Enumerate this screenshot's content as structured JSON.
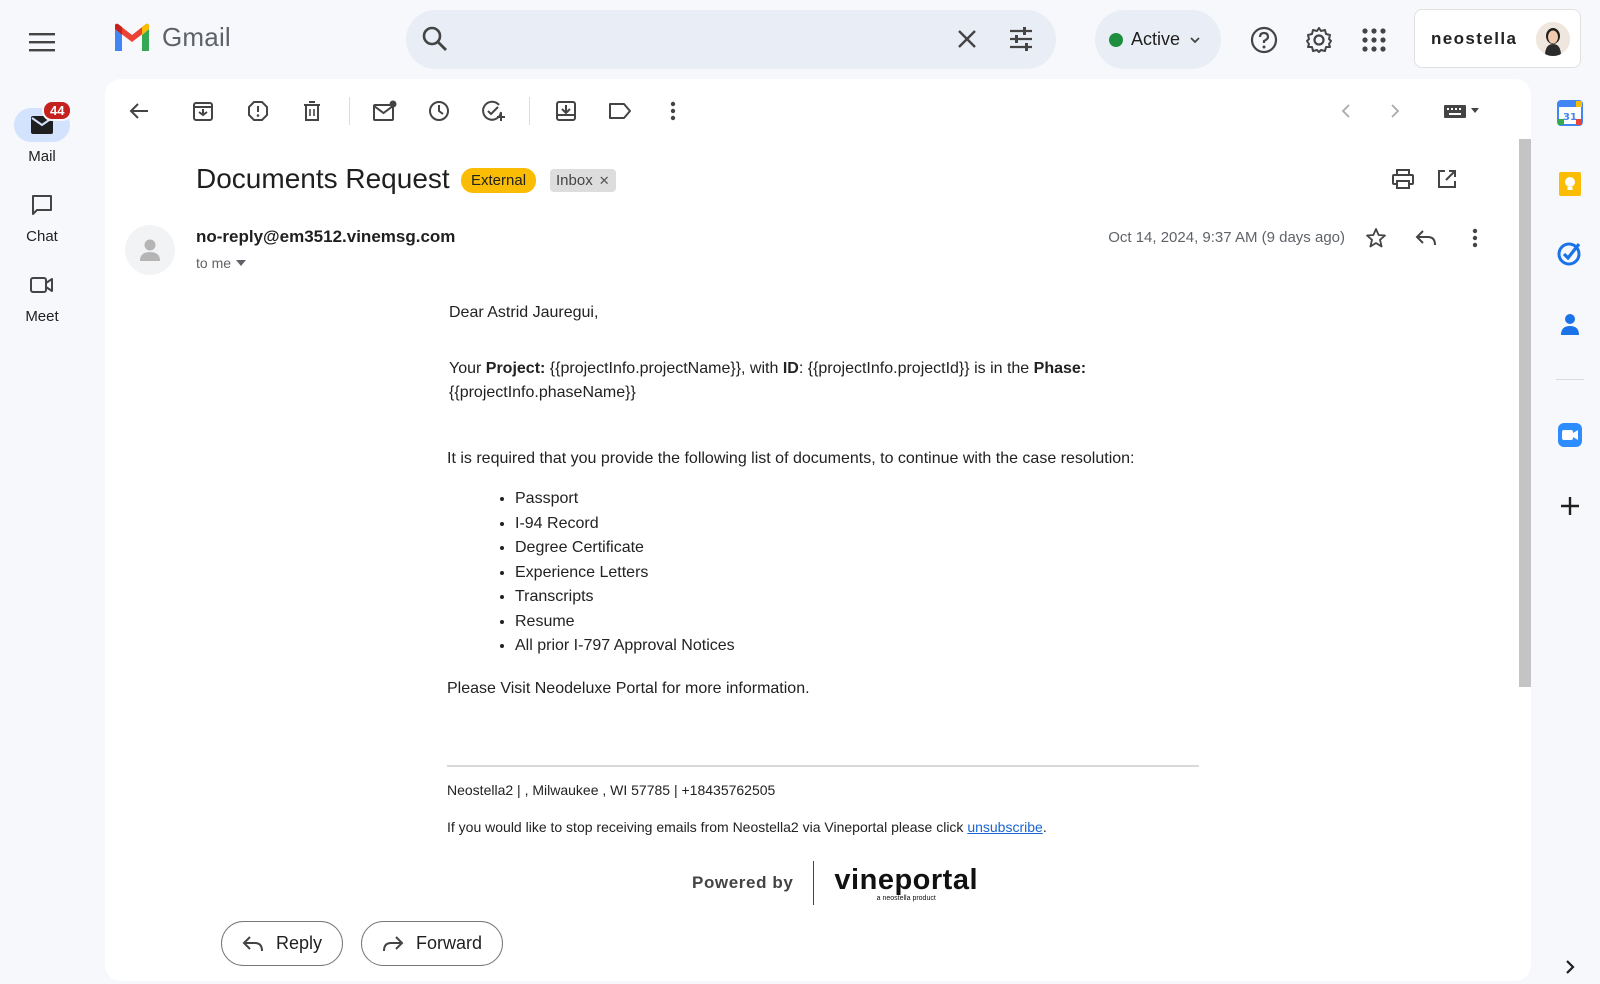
{
  "app": {
    "logo_text": "Gmail"
  },
  "search": {
    "value": "",
    "placeholder": ""
  },
  "status": {
    "label": "Active",
    "color": "#1e8e3e"
  },
  "account": {
    "brand": "neostella"
  },
  "rail": [
    {
      "label": "Mail",
      "badge": "44",
      "icon": "mail-icon",
      "active": true
    },
    {
      "label": "Chat",
      "icon": "chat-icon"
    },
    {
      "label": "Meet",
      "icon": "video-icon"
    }
  ],
  "email": {
    "subject": "Documents Request",
    "labels": {
      "external": "External",
      "inbox": "Inbox"
    },
    "sender": "no-reply@em3512.vinemsg.com",
    "to": "to me",
    "date": "Oct 14, 2024, 9:37 AM (9 days ago)",
    "greeting": "Dear Astrid Jauregui,",
    "para1": {
      "t1": "Your ",
      "b1": "Project:",
      "t2": " {{projectInfo.projectName}}, with ",
      "b2": "ID",
      "t3": ": {{projectInfo.projectId}} is in the ",
      "b3": "Phase:",
      "t4": "{{projectInfo.phaseName}}"
    },
    "para2": "It is required that you provide the following list of documents, to continue with the case resolution:",
    "documents": [
      "Passport",
      "I-94 Record",
      "Degree Certificate",
      "Experience Letters",
      "Transcripts",
      "Resume",
      "All prior I-797 Approval Notices"
    ],
    "para3": "Please Visit Neodeluxe Portal for more information.",
    "footer_address": "Neostella2 | , Milwaukee , WI 57785 | +18435762505",
    "unsub_text": "If you would like to stop receiving emails from Neostella2 via Vineportal please click ",
    "unsub_link": "unsubscribe",
    "unsub_end": ".",
    "powered_by": "Powered by",
    "vineportal": "vineportal",
    "vineportal_sub": "a neostella product"
  },
  "actions": {
    "reply": "Reply",
    "forward": "Forward"
  },
  "colors": {
    "accent": "#d3e3fd",
    "external_chip": "#fbbc04",
    "badge": "#c5221f",
    "link": "#1a66d2"
  }
}
